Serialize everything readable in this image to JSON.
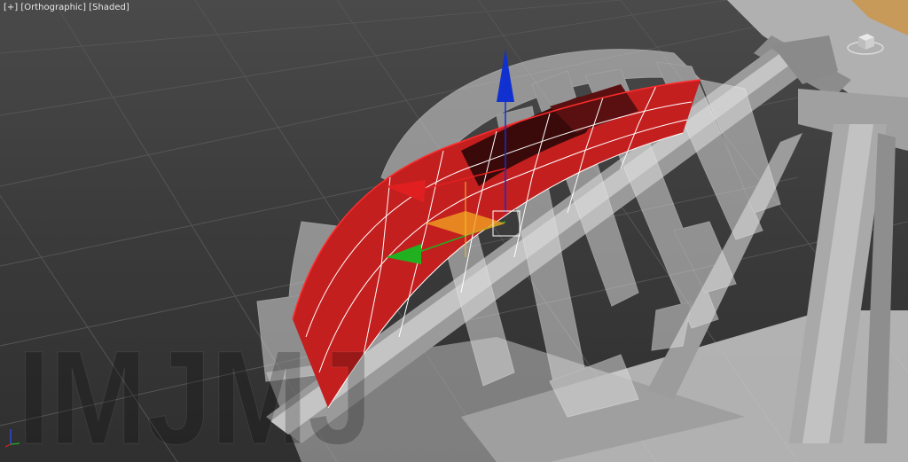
{
  "viewport": {
    "label_plus": "[+]",
    "label_view": "[Orthographic]",
    "label_shading": "[Shaded]"
  },
  "watermark": "IMJMJ",
  "colors": {
    "background": "#3a3a3a",
    "grid": "#555555",
    "selection": "#cc2020",
    "wire": "#ffffff",
    "frame": "#b8b8b8",
    "gizmo_x": "#e02020",
    "gizmo_y": "#20b020",
    "gizmo_z": "#1030d0",
    "gizmo_plane": "#f0a020"
  },
  "icons": {
    "viewcube": "viewcube-icon",
    "axis_tripod": "axis-tripod-icon",
    "move_gizmo": "move-gizmo-icon"
  }
}
